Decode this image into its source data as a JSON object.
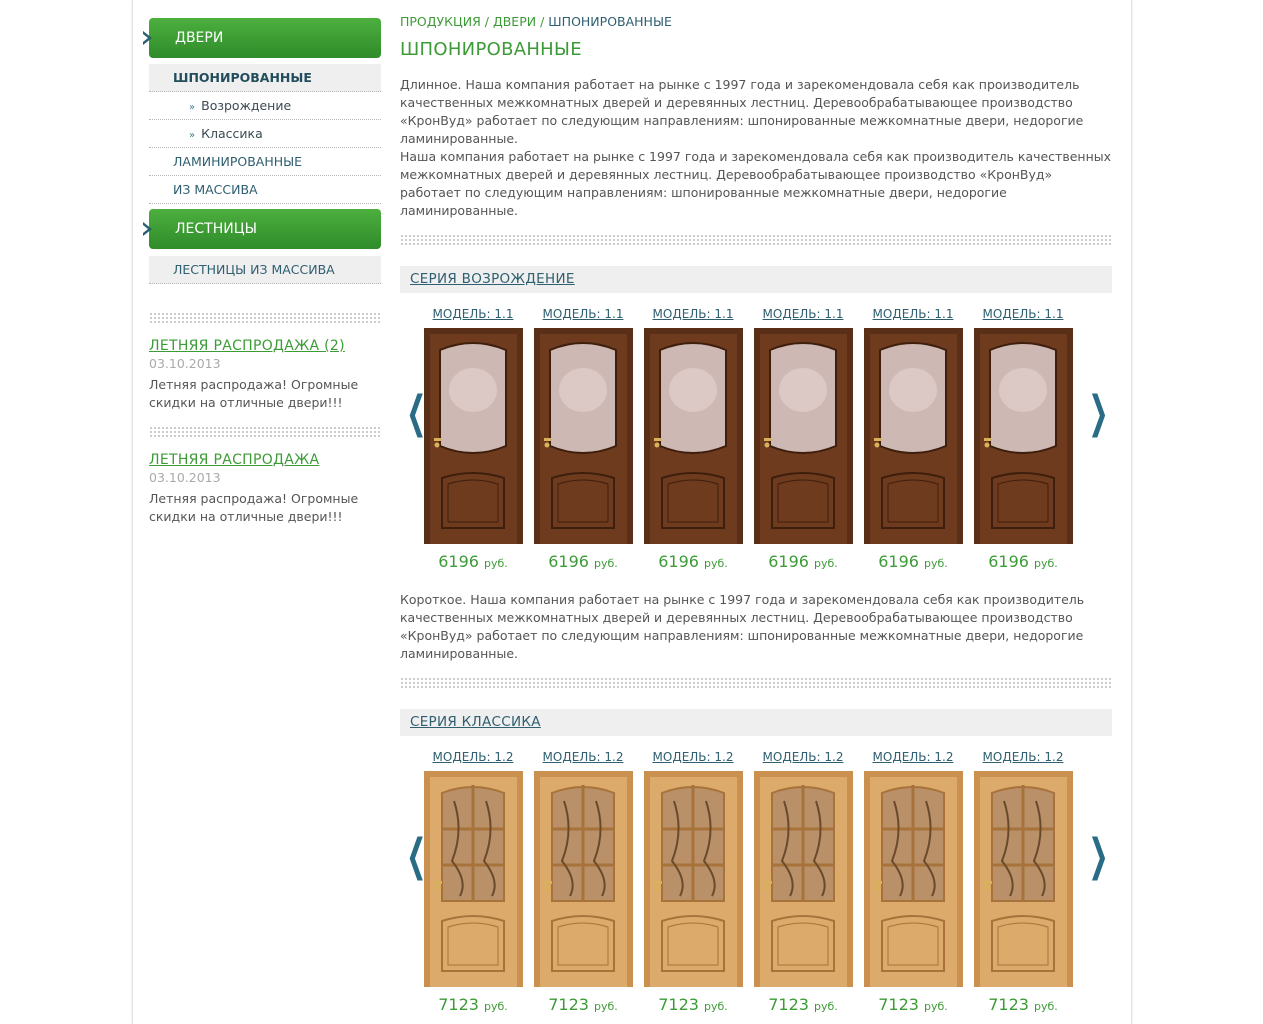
{
  "sidebar": {
    "doors_label": "ДВЕРИ",
    "veneer_label": "ШПОНИРОВАННЫЕ",
    "vozrozhdenie_label": "Возрождение",
    "klassika_label": "Классика",
    "laminated_label": "ЛАМИНИРОВАННЫЕ",
    "solid_label": "ИЗ МАССИВА",
    "stairs_label": "ЛЕСТНИЦЫ",
    "stairs_solid_label": "ЛЕСТНИЦЫ ИЗ МАССИВА"
  },
  "news": [
    {
      "title": "ЛЕТНЯЯ РАСПРОДАЖА (2)",
      "date": "03.10.2013",
      "text": "Летняя распродажа! Огромные скидки на отличные двери!!!"
    },
    {
      "title": "ЛЕТНЯЯ РАСПРОДАЖА",
      "date": "03.10.2013",
      "text": "Летняя распродажа! Огромные скидки на отличные двери!!!"
    }
  ],
  "breadcrumb": {
    "products": "ПРОДУКЦИЯ",
    "doors": "ДВЕРИ",
    "current": "ШПОНИРОВАННЫЕ",
    "sep": "/"
  },
  "page_title": "ШПОНИРОВАННЫЕ",
  "long_description": "Длинное. Наша компания работает на рынке с 1997 года и зарекомендовала себя как производитель качественных межкомнатных дверей и деревянных лестниц. Деревообрабатывающее производство «КронВуд» работает по следующим направлениям: шпонированные межкомнатные двери, недорогие ламинированные.\nНаша компания работает на рынке с 1997 года и зарекомендовала себя как производитель качественных межкомнатных дверей и деревянных лестниц. Деревообрабатывающее производство «КронВуд» работает по следующим направлениям: шпонированные межкомнатные двери, недорогие ламинированные.",
  "short_description": "Короткое. Наша компания работает на рынке с 1997 года и зарекомендовала себя как производитель качественных межкомнатных дверей и деревянных лестниц. Деревообрабатывающее производство «КронВуд» работает по следующим направлениям: шпонированные межкомнатные двери, недорогие ламинированные.",
  "series": [
    {
      "title": "СЕРИЯ ВОЗРОЖДЕНИЕ",
      "door_style": "dark",
      "products": [
        {
          "model": "МОДЕЛЬ: 1.1",
          "price": "6196",
          "currency": "руб."
        },
        {
          "model": "МОДЕЛЬ: 1.1",
          "price": "6196",
          "currency": "руб."
        },
        {
          "model": "МОДЕЛЬ: 1.1",
          "price": "6196",
          "currency": "руб."
        },
        {
          "model": "МОДЕЛЬ: 1.1",
          "price": "6196",
          "currency": "руб."
        },
        {
          "model": "МОДЕЛЬ: 1.1",
          "price": "6196",
          "currency": "руб."
        },
        {
          "model": "МОДЕЛЬ: 1.1",
          "price": "6196",
          "currency": "руб."
        }
      ]
    },
    {
      "title": "СЕРИЯ КЛАССИКА",
      "door_style": "light",
      "products": [
        {
          "model": "МОДЕЛЬ: 1.2",
          "price": "7123",
          "currency": "руб."
        },
        {
          "model": "МОДЕЛЬ: 1.2",
          "price": "7123",
          "currency": "руб."
        },
        {
          "model": "МОДЕЛЬ: 1.2",
          "price": "7123",
          "currency": "руб."
        },
        {
          "model": "МОДЕЛЬ: 1.2",
          "price": "7123",
          "currency": "руб."
        },
        {
          "model": "МОДЕЛЬ: 1.2",
          "price": "7123",
          "currency": "руб."
        },
        {
          "model": "МОДЕЛЬ: 1.2",
          "price": "7123",
          "currency": "руб."
        }
      ]
    }
  ],
  "carousel": {
    "prev_icon": "chevron-left-icon",
    "next_icon": "chevron-right-icon",
    "prev_glyph": "❮",
    "next_glyph": "❯"
  },
  "colors": {
    "green": "#3d9b37",
    "teal": "#2f5f70",
    "dark_door": "#6b3a1f",
    "light_door": "#d9a766"
  }
}
